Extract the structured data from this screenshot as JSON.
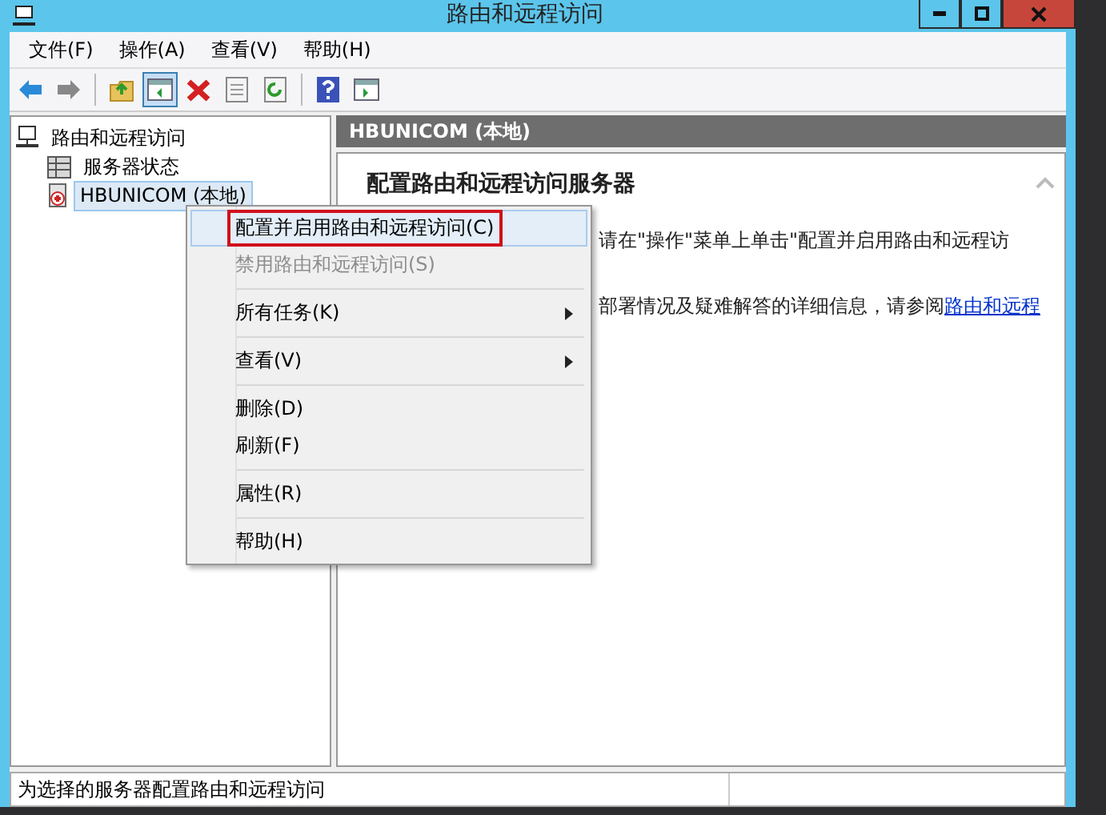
{
  "window": {
    "title": "路由和远程访问"
  },
  "menu_bar": [
    "文件(F)",
    "操作(A)",
    "查看(V)",
    "帮助(H)"
  ],
  "toolbar": [
    {
      "kind": "back",
      "pressed": false
    },
    {
      "kind": "forward",
      "pressed": false
    },
    {
      "kind": "separator"
    },
    {
      "kind": "up",
      "pressed": false
    },
    {
      "kind": "tree",
      "pressed": true
    },
    {
      "kind": "delete",
      "pressed": false
    },
    {
      "kind": "properties",
      "pressed": false
    },
    {
      "kind": "refresh",
      "pressed": false
    },
    {
      "kind": "separator"
    },
    {
      "kind": "help",
      "pressed": false
    },
    {
      "kind": "action",
      "pressed": false
    }
  ],
  "tree": [
    {
      "label": "路由和远程访问",
      "kind": "root",
      "selected": false,
      "children": [
        {
          "label": "服务器状态",
          "kind": "status",
          "selected": false
        },
        {
          "label": "HBUNICOM (本地)",
          "kind": "server",
          "selected": true
        }
      ]
    }
  ],
  "details": {
    "header": "HBUNICOM (本地)",
    "heading": "配置路由和远程访问服务器",
    "lines": [
      {
        "text": "请在\"操作\"菜单上单击\"配置并启用路由和远程访"
      },
      {
        "text": "部署情况及疑难解答的详细信息，请参阅",
        "link": "路由和远程"
      }
    ]
  },
  "context_menu": [
    {
      "kind": "item",
      "label": "配置并启用路由和远程访问(C)",
      "selected": true,
      "disabled": false,
      "submenu": false
    },
    {
      "kind": "item",
      "label": "禁用路由和远程访问(S)",
      "selected": false,
      "disabled": true,
      "submenu": false
    },
    {
      "kind": "separator"
    },
    {
      "kind": "item",
      "label": "所有任务(K)",
      "selected": false,
      "disabled": false,
      "submenu": true
    },
    {
      "kind": "separator"
    },
    {
      "kind": "item",
      "label": "查看(V)",
      "selected": false,
      "disabled": false,
      "submenu": true
    },
    {
      "kind": "separator"
    },
    {
      "kind": "item",
      "label": "删除(D)",
      "selected": false,
      "disabled": false,
      "submenu": false
    },
    {
      "kind": "item",
      "label": "刷新(F)",
      "selected": false,
      "disabled": false,
      "submenu": false
    },
    {
      "kind": "separator"
    },
    {
      "kind": "item",
      "label": "属性(R)",
      "selected": false,
      "disabled": false,
      "submenu": false
    },
    {
      "kind": "separator"
    },
    {
      "kind": "item",
      "label": "帮助(H)",
      "selected": false,
      "disabled": false,
      "submenu": false
    }
  ],
  "status_bar": "为选择的服务器配置路由和远程访问"
}
